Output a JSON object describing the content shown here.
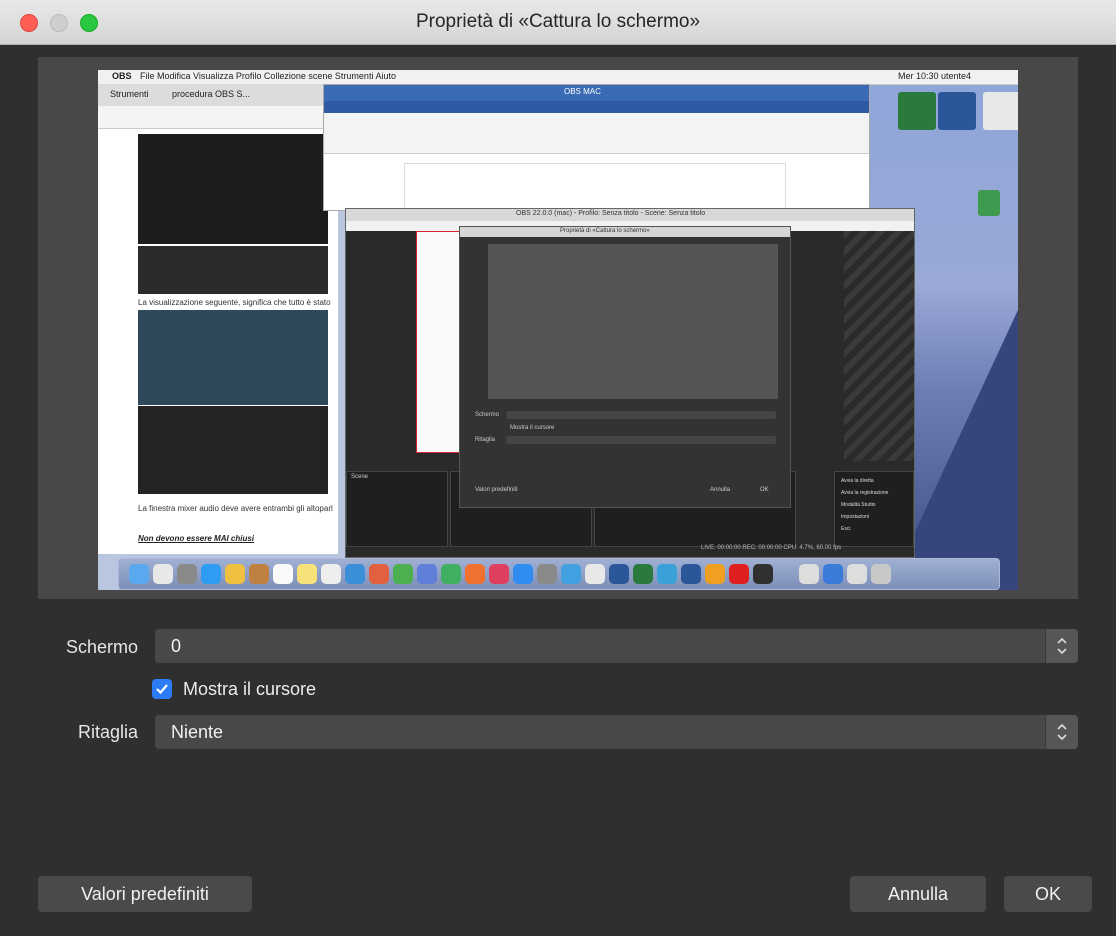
{
  "window": {
    "title": "Proprietà di «Cattura lo schermo»"
  },
  "preview": {
    "browser_tab1": "Strumenti",
    "browser_tab2": "procedura OBS S...",
    "menubar_app": "OBS",
    "menubar_items": "File  Modifica  Visualizza  Profilo  Collezione scene  Strumenti  Aiuto",
    "menubar_clock": "Mer 10:30  utente4",
    "word_title": "OBS MAC",
    "doc_text1": "La visualizzazione seguente, significa che tutto è stato impostato",
    "doc_text2": "La finestra mixer audio deve avere entrambi gli altoparlanti",
    "doc_text3": "Non devono essere MAI chiusi",
    "obs_title": "OBS 22.0.0 (mac) - Profilo: Senza titolo - Scene: Senza titolo",
    "nested_title": "Proprietà di «Cattura lo schermo»",
    "nested_screen": "Schermo",
    "nested_cursor": "Mostra il cursore",
    "nested_crop": "Ritaglia",
    "nested_defaults": "Valori predefiniti",
    "nested_cancel": "Annulla",
    "nested_ok": "OK",
    "status": "LIVE: 00:00:00   REC: 00:00:00   CPU: 4.7%, 60.00 fps",
    "scenes_header": "Scene",
    "controls": [
      "Avvia la diretta",
      "Avvia la registrazione",
      "Modalità Studio",
      "Impostazioni",
      "Esci"
    ]
  },
  "form": {
    "screen_label": "Schermo",
    "screen_value": "0",
    "cursor_label": "Mostra il cursore",
    "cursor_checked": true,
    "crop_label": "Ritaglia",
    "crop_value": "Niente"
  },
  "buttons": {
    "defaults": "Valori predefiniti",
    "cancel": "Annulla",
    "ok": "OK"
  },
  "colors": {
    "accent": "#2d7cf6",
    "close": "#fd5f57",
    "maximize": "#2ac840"
  }
}
